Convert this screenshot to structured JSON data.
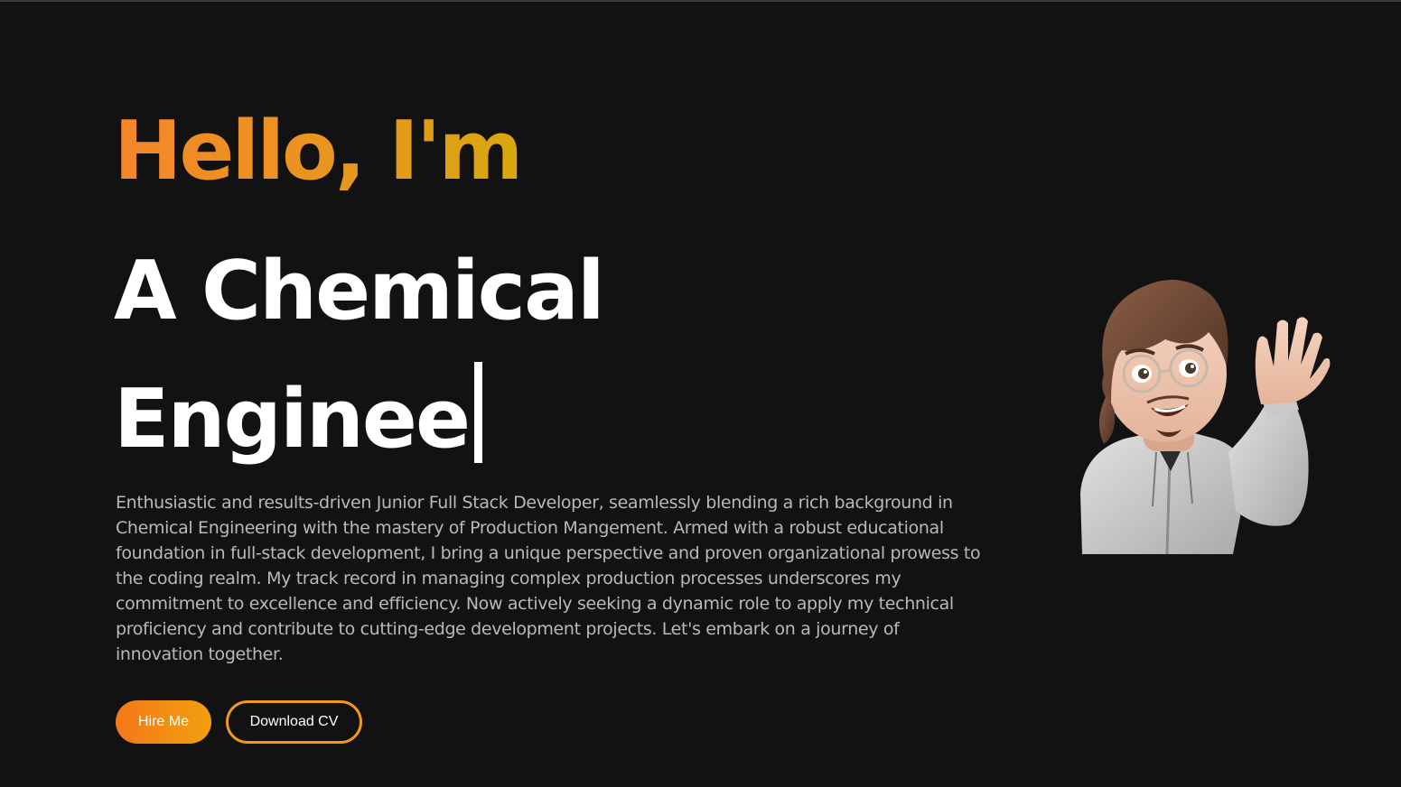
{
  "hero": {
    "greeting": "Hello, I'm",
    "role_line1": "A Chemical",
    "role_line2": "Enginee",
    "bio": "Enthusiastic and results-driven Junior Full Stack Developer, seamlessly blending a rich background in Chemical Engineering with the mastery of Production Mangement. Armed with a robust educational foundation in full-stack development, I bring a unique perspective and proven organizational prowess to the coding realm. My track record in managing complex production processes underscores my commitment to excellence and efficiency. Now actively seeking a dynamic role to apply my technical proficiency and contribute to cutting-edge development projects. Let's embark on a journey of innovation together.",
    "hire_label": "Hire Me",
    "cv_label": "Download CV",
    "avatar_icon": "waving-memoji-avatar"
  },
  "colors": {
    "background": "#121212",
    "accent_orange": "#f5862b",
    "accent_gold": "#d8a70f",
    "text_white": "#ffffff",
    "text_muted": "#b9b9b9"
  }
}
